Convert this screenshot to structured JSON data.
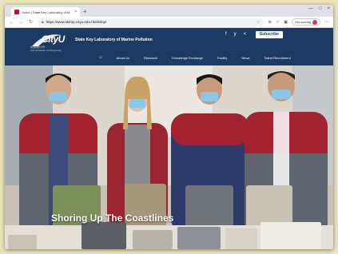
{
  "browser": {
    "tab_title": "Home | State Key Laboratory of M",
    "tab_close": "×",
    "new_tab": "+",
    "window_controls": [
      "—",
      "□",
      "×"
    ],
    "url": "https://www.sklmp.cityu.edu.hk/sklmp/",
    "sync_label": "Not syncing",
    "icons": [
      "back-icon",
      "forward-icon",
      "reload-icon",
      "lock-icon",
      "star-icon",
      "extensions-icon",
      "menu-icon"
    ]
  },
  "site": {
    "logo_text": "CityU",
    "logo_sub_zh": "香港城市大學",
    "logo_sub_en": "City University of Hong Kong",
    "lab_title": "State Key Laboratory of Marine Pollution",
    "subscribe_label": "Subscribe",
    "social": [
      "f",
      "y",
      "<"
    ],
    "nav": [
      "About Us",
      "Research",
      "Knowledge Exchange",
      "Facility",
      "News",
      "Talent Recruitment"
    ]
  },
  "hero": {
    "headline": "Shoring Up The Coastlines"
  },
  "colors": {
    "header_bg": "#1d3a63",
    "jacket_red": "#a3222f",
    "jacket_grey": "#6a7078",
    "page_bg": "#e9e3b8"
  }
}
